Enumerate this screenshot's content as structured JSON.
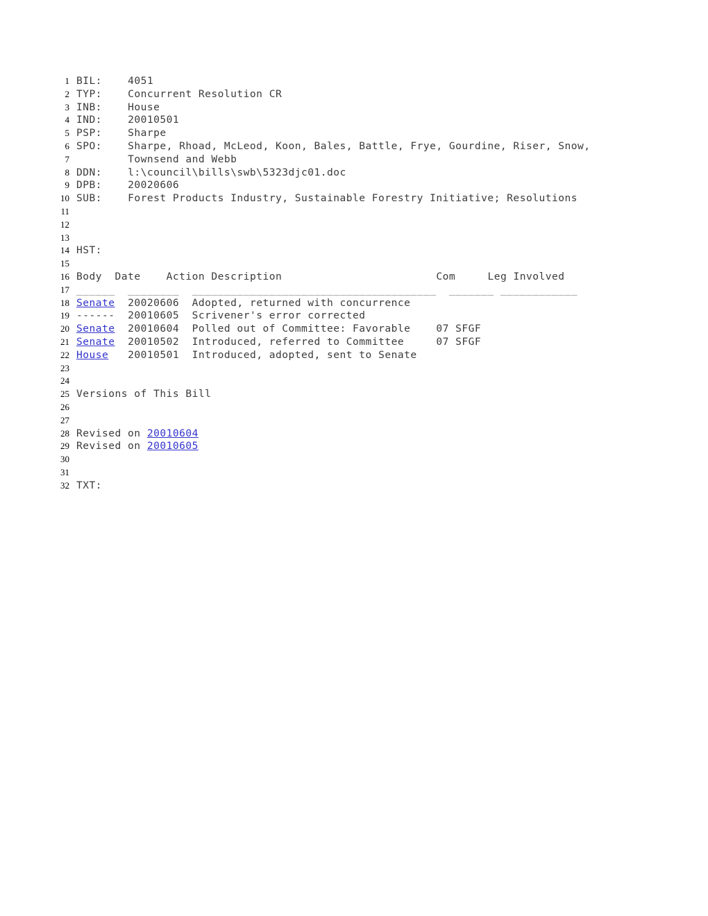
{
  "document": {
    "kind": "legislative-bill-record",
    "bill_number": "4051",
    "line_number_start": 1,
    "line_number_end": 32,
    "link_color": "#3333cc",
    "text_color": "#3b3b3b",
    "background_color": "#ffffff"
  },
  "fields": {
    "bil_label": "BIL:",
    "bil_value": "4051",
    "typ_label": "TYP:",
    "typ_value": "Concurrent Resolution CR",
    "inb_label": "INB:",
    "inb_value": "House",
    "ind_label": "IND:",
    "ind_value": "20010501",
    "psp_label": "PSP:",
    "psp_value": "Sharpe",
    "spo_label": "SPO:",
    "spo_value_line1": "Sharpe, Rhoad, McLeod, Koon, Bales, Battle, Frye, Gourdine, Riser, Snow,",
    "spo_value_line2": "Townsend and Webb",
    "ddn_label": "DDN:",
    "ddn_value": "l:\\council\\bills\\swb\\5323djc01.doc",
    "dpb_label": "DPB:",
    "dpb_value": "20020606",
    "sub_label": "SUB:",
    "sub_value": "Forest Products Industry, Sustainable Forestry Initiative; Resolutions",
    "hst_label": "HST:",
    "txt_label": "TXT:"
  },
  "history_table": {
    "headers": {
      "body": "Body",
      "date": "Date",
      "action": "Action Description",
      "com": "Com",
      "leg": "Leg Involved"
    },
    "rule": {
      "body": "______",
      "date": "________",
      "action": "______________________________________",
      "com": "_______",
      "leg": "____________"
    },
    "rows": [
      {
        "body": "Senate",
        "body_is_link": true,
        "date": "20020606",
        "action": "Adopted, returned with concurrence",
        "com": "",
        "leg": ""
      },
      {
        "body": "------",
        "body_is_link": false,
        "date": "20010605",
        "action": "Scrivener's error corrected",
        "com": "",
        "leg": ""
      },
      {
        "body": "Senate",
        "body_is_link": true,
        "date": "20010604",
        "action": "Polled out of Committee: Favorable",
        "com": "07 SFGF",
        "leg": ""
      },
      {
        "body": "Senate",
        "body_is_link": true,
        "date": "20010502",
        "action": "Introduced, referred to Committee",
        "com": "07 SFGF",
        "leg": ""
      },
      {
        "body": "House",
        "body_is_link": true,
        "date": "20010501",
        "action": "Introduced, adopted, sent to Senate",
        "com": "",
        "leg": ""
      }
    ]
  },
  "versions": {
    "heading": "Versions of This Bill",
    "items": [
      {
        "prefix": "Revised on ",
        "date": "20010604"
      },
      {
        "prefix": "Revised on ",
        "date": "20010605"
      }
    ]
  },
  "line_numbers": {
    "n1": "1",
    "n2": "2",
    "n3": "3",
    "n4": "4",
    "n5": "5",
    "n6": "6",
    "n7": "7",
    "n8": "8",
    "n9": "9",
    "n10": "10",
    "n11": "11",
    "n12": "12",
    "n13": "13",
    "n14": "14",
    "n15": "15",
    "n16": "16",
    "n17": "17",
    "n18": "18",
    "n19": "19",
    "n20": "20",
    "n21": "21",
    "n22": "22",
    "n23": "23",
    "n24": "24",
    "n25": "25",
    "n26": "26",
    "n27": "27",
    "n28": "28",
    "n29": "29",
    "n30": "30",
    "n31": "31",
    "n32": "32"
  },
  "spacing": {
    "field_gap": "    ",
    "field_indent": "        ",
    "col_body_pad": "  ",
    "col_date_pad": "  ",
    "col_action_pad": "  "
  }
}
